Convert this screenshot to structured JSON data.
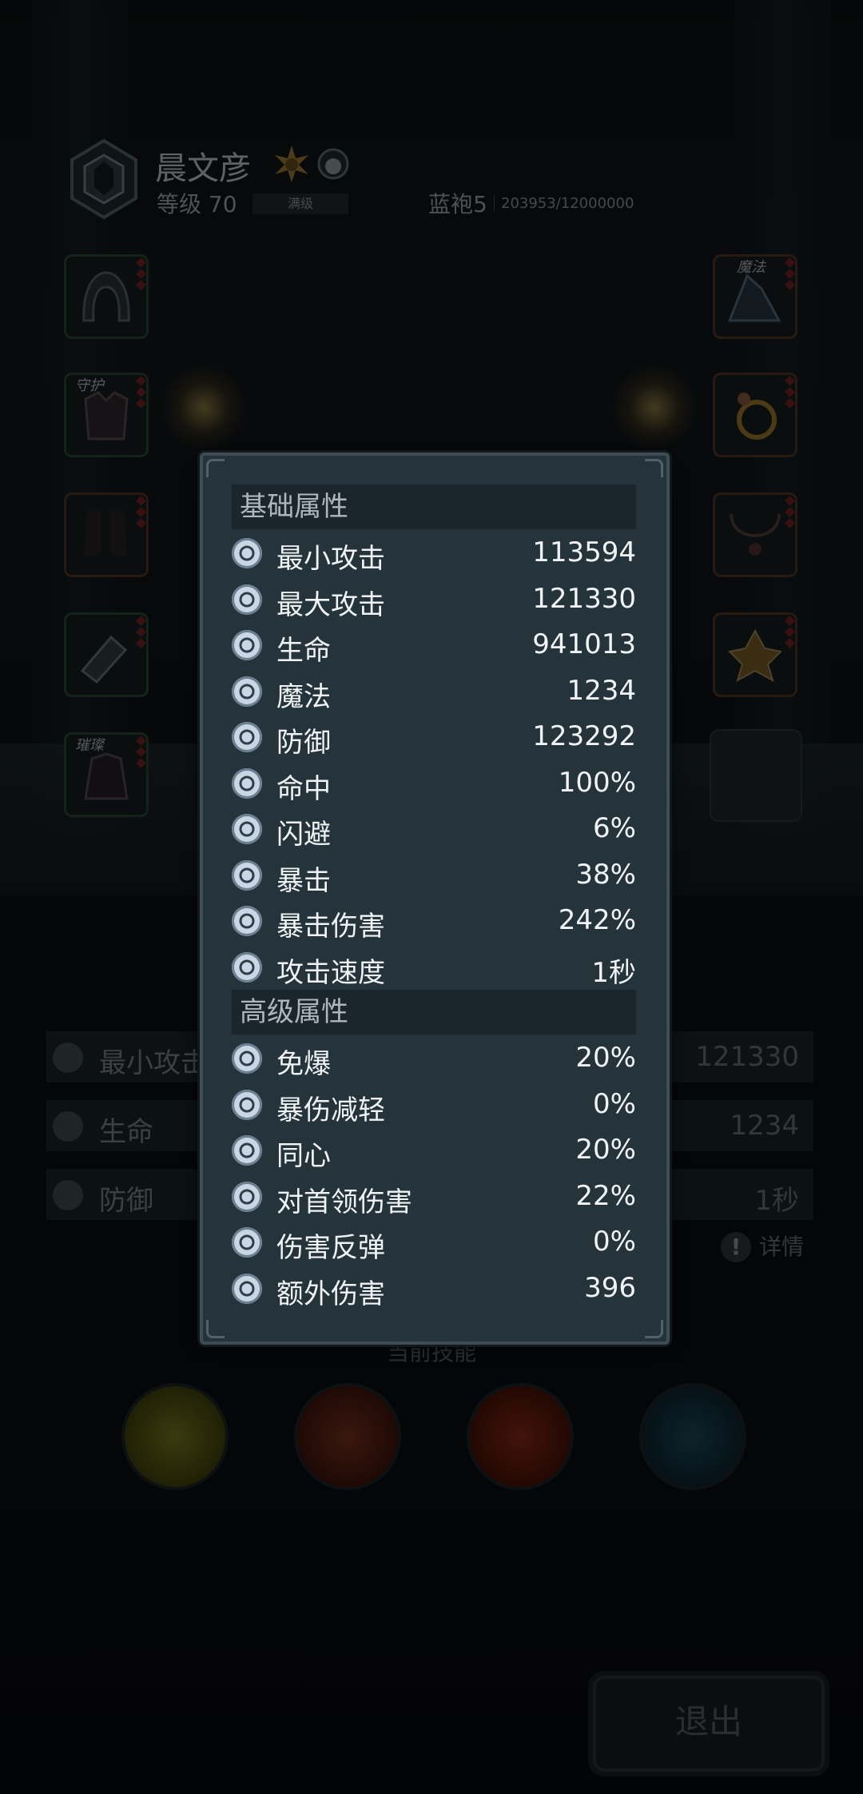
{
  "header": {
    "name": "晨文彦",
    "level": "等级 70",
    "max_badge": "满级",
    "robe": "蓝袍5",
    "exp": "203953/12000000"
  },
  "equipment": {
    "left": [
      {
        "label": "",
        "icon": "hood-icon"
      },
      {
        "label": "守护",
        "icon": "armor-icon"
      },
      {
        "label": "",
        "icon": "boots-icon"
      },
      {
        "label": "",
        "icon": "bracer-icon"
      },
      {
        "label": "璀璨",
        "icon": "cloak-icon"
      }
    ],
    "right": [
      {
        "label": "魔法",
        "icon": "hat-icon"
      },
      {
        "label": "",
        "icon": "ring-icon"
      },
      {
        "label": "",
        "icon": "necklace-icon"
      },
      {
        "label": "",
        "icon": "amulet-icon"
      }
    ]
  },
  "background_stats": {
    "rows": [
      {
        "label": "最小攻击",
        "value": "121330"
      },
      {
        "label": "生命",
        "value": "1234"
      },
      {
        "label": "防御",
        "value": "1秒"
      }
    ],
    "detail": "详情"
  },
  "skills": {
    "title": "当前技能"
  },
  "exit_button": "退出",
  "popup": {
    "basic_title": "基础属性",
    "basic": [
      {
        "label": "最小攻击",
        "value": "113594",
        "icon": "sword-icon"
      },
      {
        "label": "最大攻击",
        "value": "121330",
        "icon": "sword-icon"
      },
      {
        "label": "生命",
        "value": "941013",
        "icon": "heart-icon"
      },
      {
        "label": "魔法",
        "value": "1234",
        "icon": "magic-icon"
      },
      {
        "label": "防御",
        "value": "123292",
        "icon": "shield-icon"
      },
      {
        "label": "命中",
        "value": "100%",
        "icon": "target-icon"
      },
      {
        "label": "闪避",
        "value": "6%",
        "icon": "dodge-icon"
      },
      {
        "label": "暴击",
        "value": "38%",
        "icon": "crit-icon"
      },
      {
        "label": "暴击伤害",
        "value": "242%",
        "icon": "crit-damage-icon"
      },
      {
        "label": "攻击速度",
        "value": "1秒",
        "icon": "speed-icon"
      }
    ],
    "advanced_title": "高级属性",
    "advanced": [
      {
        "label": "免爆",
        "value": "20%",
        "icon": "crit-immune-icon"
      },
      {
        "label": "暴伤减轻",
        "value": "0%",
        "icon": "crit-reduce-icon"
      },
      {
        "label": "同心",
        "value": "20%",
        "icon": "unity-icon"
      },
      {
        "label": "对首领伤害",
        "value": "22%",
        "icon": "boss-damage-icon"
      },
      {
        "label": "伤害反弹",
        "value": "0%",
        "icon": "reflect-icon"
      },
      {
        "label": "额外伤害",
        "value": "396",
        "icon": "extra-damage-icon"
      }
    ]
  }
}
